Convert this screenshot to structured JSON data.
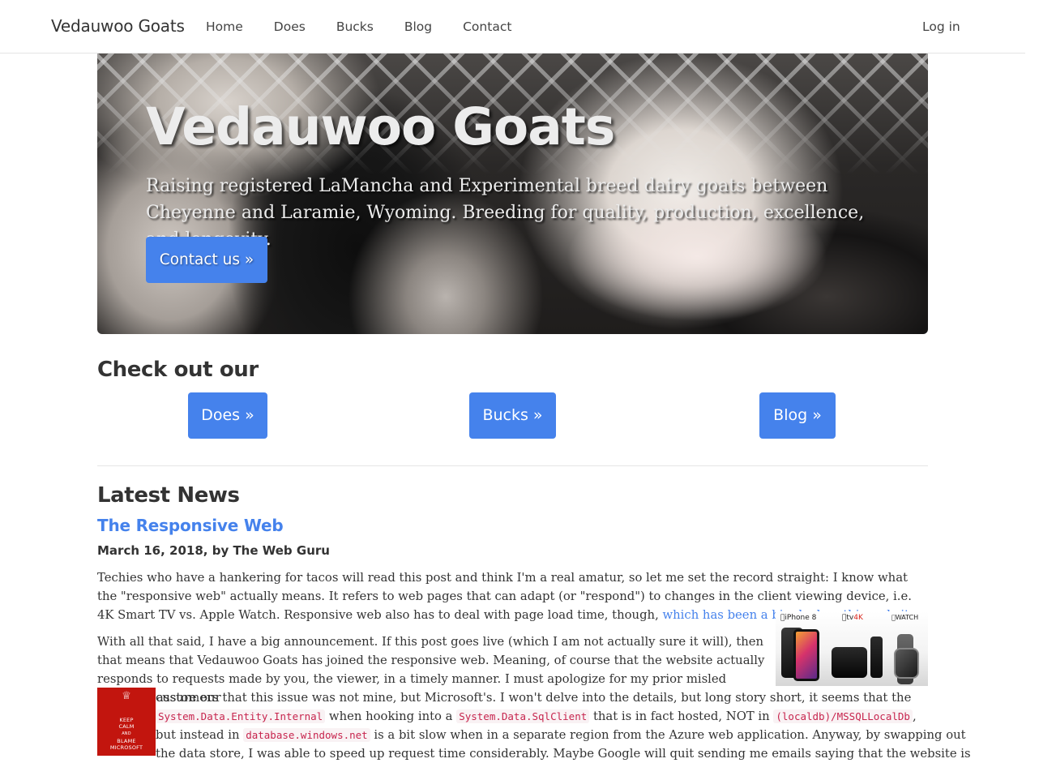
{
  "nav": {
    "brand": "Vedauwoo Goats",
    "links": [
      "Home",
      "Does",
      "Bucks",
      "Blog",
      "Contact"
    ],
    "login": "Log in"
  },
  "hero": {
    "title": "Vedauwoo Goats",
    "subtitle": "Raising registered LaMancha and Experimental breed dairy goats between Cheyenne and Laramie, Wyoming. Breeding for quality, production, excellence, and longevity.",
    "button": "Contact us »"
  },
  "checkout": {
    "heading": "Check out our",
    "buttons": [
      "Does »",
      "Bucks »",
      "Blog »"
    ]
  },
  "news": {
    "heading": "Latest News",
    "post": {
      "title": "The Responsive Web",
      "meta": "March 16, 2018, by The Web Guru",
      "p1": "Techies who have a hankering for tacos will read this post and think I'm a real amatur, so let me set the record straight: I know what the \"responsive web\" actually means. It refers to web pages that can adapt (or \"respond\") to changes in the client viewing device, i.e. 4K Smart TV vs. Apple Watch.  Responsive web also has to deal with page load time, though, ",
      "p1_link": "which has been a big deal on this website",
      "p1_end": ".",
      "p2_a": "With all that said, I have a big announcement. If this post goes live (which I am not actually sure it will), then that means that Vedauwoo Goats has joined the responsive web. Meaning, of course that the website actually responds to requests made by you, the viewer, in a timely manner. I must apologize for my prior misled efforts to assure our",
      "p2_b": "customers that this issue was not mine, but Microsoft's.  I won't delve into the details, but long story short, it seems that the",
      "code1": "System.Data.Entity.Internal",
      "p2_c": " when hooking into a ",
      "code2": "System.Data.SqlClient",
      "p2_d": " that is in fact hosted, NOT in ",
      "code3": "(localdb)/MSSQLLocalDb",
      "p2_e": ",",
      "p2_f": "but instead in ",
      "code4": "database.windows.net",
      "p2_g": " is a bit slow when in a separate region from the Azure web application. Anyway, by swapping out",
      "p2_h": "the data store, I was able to speed up request time considerably. Maybe Google will quit sending me emails saying that the website is"
    }
  },
  "devices_image": {
    "label_iphone": "iPhone 8",
    "label_tv": "tv",
    "label_tv_k": "4K",
    "label_watch": "WATCH"
  },
  "keepcalm_image": {
    "line1": "KEEP",
    "line2": "CALM",
    "line3": "AND",
    "line4": "BLAME",
    "line5": "MICROSOFT"
  },
  "colors": {
    "accent": "#4582ec",
    "code_text": "#c7254e",
    "code_bg": "#f9f2f4",
    "keepcalm_red": "#c2150e"
  }
}
